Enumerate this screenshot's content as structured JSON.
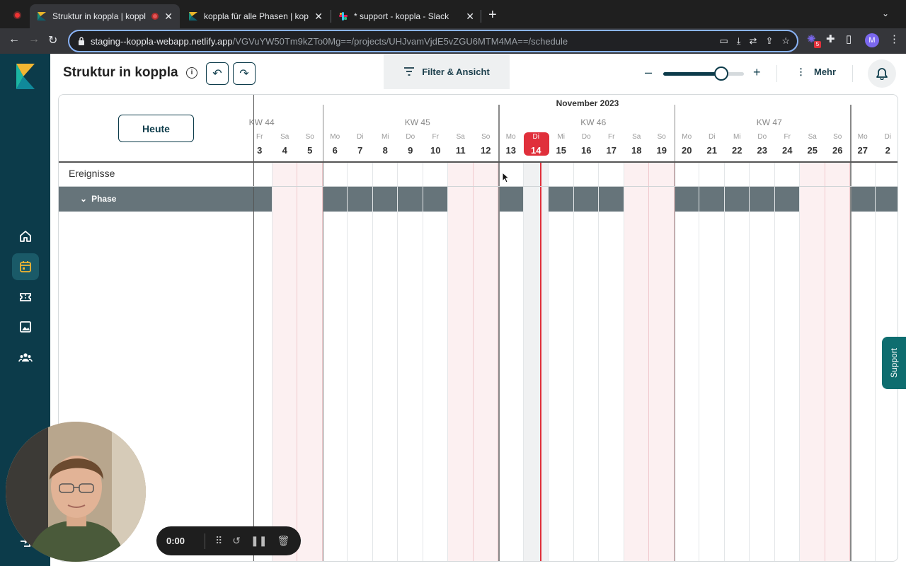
{
  "browser": {
    "tabs": [
      {
        "title": "Struktur in koppla | koppla",
        "active": true,
        "recording": true
      },
      {
        "title": "koppla für alle Phasen | koppla",
        "active": false
      },
      {
        "title": "* support - koppla - Slack",
        "active": false
      }
    ],
    "url_host": "staging--koppla-webapp.netlify.app",
    "url_path": "/VGVuYW50Tm9kZTo0Mg==/projects/UHJvamVjdE5vZGU6MTM4MA==/schedule",
    "profile_initial": "M",
    "extension_badge": "5"
  },
  "header": {
    "title": "Struktur in koppla",
    "filter_label": "Filter & Ansicht",
    "more_label": "Mehr",
    "zoom_level": 0.72
  },
  "schedule": {
    "today_label": "Heute",
    "events_label": "Ereignisse",
    "phase_label": "Phase",
    "month_label": "November 2023",
    "weeks": [
      {
        "label": "KW 44"
      },
      {
        "label": "KW 45"
      },
      {
        "label": "KW 46"
      },
      {
        "label": "KW 47"
      }
    ],
    "days": [
      {
        "name": "Fr",
        "num": "3",
        "weekend": false
      },
      {
        "name": "Sa",
        "num": "4",
        "weekend": true
      },
      {
        "name": "So",
        "num": "5",
        "weekend": true
      },
      {
        "name": "Mo",
        "num": "6",
        "weekend": false
      },
      {
        "name": "Di",
        "num": "7",
        "weekend": false
      },
      {
        "name": "Mi",
        "num": "8",
        "weekend": false
      },
      {
        "name": "Do",
        "num": "9",
        "weekend": false
      },
      {
        "name": "Fr",
        "num": "10",
        "weekend": false
      },
      {
        "name": "Sa",
        "num": "11",
        "weekend": true
      },
      {
        "name": "So",
        "num": "12",
        "weekend": true
      },
      {
        "name": "Mo",
        "num": "13",
        "weekend": false
      },
      {
        "name": "Di",
        "num": "14",
        "weekend": false,
        "today": true
      },
      {
        "name": "Mi",
        "num": "15",
        "weekend": false
      },
      {
        "name": "Do",
        "num": "16",
        "weekend": false
      },
      {
        "name": "Fr",
        "num": "17",
        "weekend": false
      },
      {
        "name": "Sa",
        "num": "18",
        "weekend": true
      },
      {
        "name": "So",
        "num": "19",
        "weekend": true
      },
      {
        "name": "Mo",
        "num": "20",
        "weekend": false
      },
      {
        "name": "Di",
        "num": "21",
        "weekend": false
      },
      {
        "name": "Mi",
        "num": "22",
        "weekend": false
      },
      {
        "name": "Do",
        "num": "23",
        "weekend": false
      },
      {
        "name": "Fr",
        "num": "24",
        "weekend": false
      },
      {
        "name": "Sa",
        "num": "25",
        "weekend": true
      },
      {
        "name": "So",
        "num": "26",
        "weekend": true
      },
      {
        "name": "Mo",
        "num": "27",
        "weekend": false
      },
      {
        "name": "Di",
        "num": "2",
        "weekend": false
      }
    ]
  },
  "support_label": "Support",
  "recorder": {
    "time": "0:00"
  },
  "colors": {
    "sidebar": "#0c3b4a",
    "accent_today": "#e0303b",
    "phase_band": "#66747a",
    "weekend": "#fcf0f1"
  }
}
